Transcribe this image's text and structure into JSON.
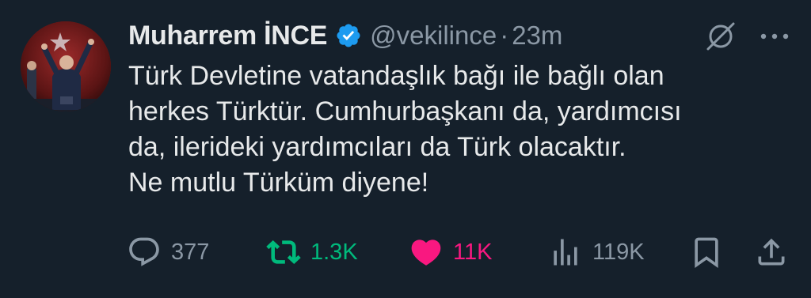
{
  "author": {
    "display_name": "Muharrem İNCE",
    "handle": "@vekilince",
    "separator": "·",
    "time": "23m",
    "verified_color": "#1d9bf0",
    "avatar_icon": "profile-photo"
  },
  "tweet": {
    "lines": [
      "Türk Devletine vatandaşlık bağı ile bağlı olan",
      "herkes Türktür. Cumhurbaşkanı da, yardımcısı",
      "da, ilerideki yardımcıları da Türk olacaktır.",
      "Ne mutlu Türküm diyene!"
    ]
  },
  "actions": {
    "reply_count": "377",
    "retweet_count": "1.3K",
    "like_count": "11K",
    "views_count": "119K",
    "retweet_color": "#00ba7c",
    "like_color": "#f91880",
    "liked": true,
    "retweeted": true
  },
  "icons": {
    "top_right": [
      "grok-icon",
      "more-icon"
    ],
    "bottom_right": [
      "bookmark-icon",
      "share-icon"
    ]
  }
}
